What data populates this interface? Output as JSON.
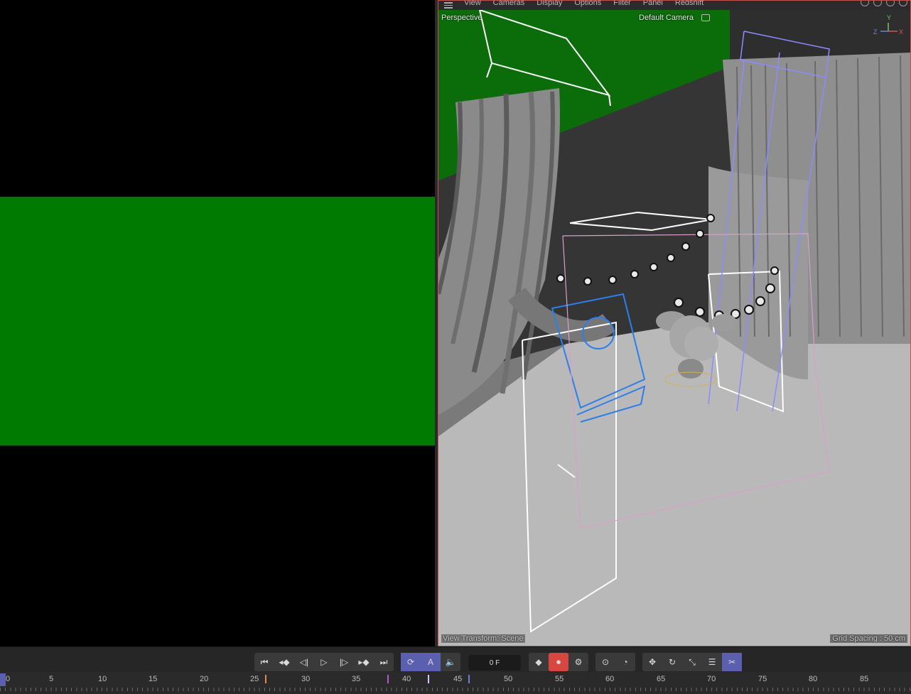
{
  "viewport": {
    "menu": [
      "View",
      "Cameras",
      "Display",
      "Options",
      "Filter",
      "Panel",
      "Redshift"
    ],
    "projection_label": "Perspective",
    "camera_label": "Default Camera",
    "view_transform": "View Transform: Scene",
    "grid_spacing": "Grid Spacing : 50 cm",
    "axis_labels": {
      "y": "Y",
      "z": "Z",
      "x": "X"
    },
    "nav_icons": [
      "pan-icon",
      "dolly-icon",
      "rotate-icon",
      "maximize-icon"
    ]
  },
  "transport": {
    "current_frame": "0 F",
    "buttons": [
      {
        "name": "go-to-start-button",
        "glyph": "⏮"
      },
      {
        "name": "previous-key-button",
        "glyph": "◂◆"
      },
      {
        "name": "previous-frame-button",
        "glyph": "◁|"
      },
      {
        "name": "play-button",
        "glyph": "▷"
      },
      {
        "name": "next-frame-button",
        "glyph": "|▷"
      },
      {
        "name": "next-key-button",
        "glyph": "▸◆"
      },
      {
        "name": "go-to-end-button",
        "glyph": "⏭"
      }
    ],
    "loop_active": true,
    "record_active": true
  },
  "timeline": {
    "ticks": [
      "0",
      "5",
      "10",
      "15",
      "20",
      "25",
      "30",
      "35",
      "40",
      "45",
      "50",
      "55",
      "60",
      "65",
      "70",
      "75",
      "80",
      "85"
    ],
    "key_colors": [
      "#e38b4a",
      "#b05ad0",
      "#c9c9ff",
      "#6b7de0"
    ]
  },
  "colors": {
    "render_background": "#007a00",
    "viewport_green_wall": "#0a6d0a",
    "active_button": "#5a5fb0",
    "record_button": "#d9453f",
    "viewport_border": "#c8504e"
  }
}
